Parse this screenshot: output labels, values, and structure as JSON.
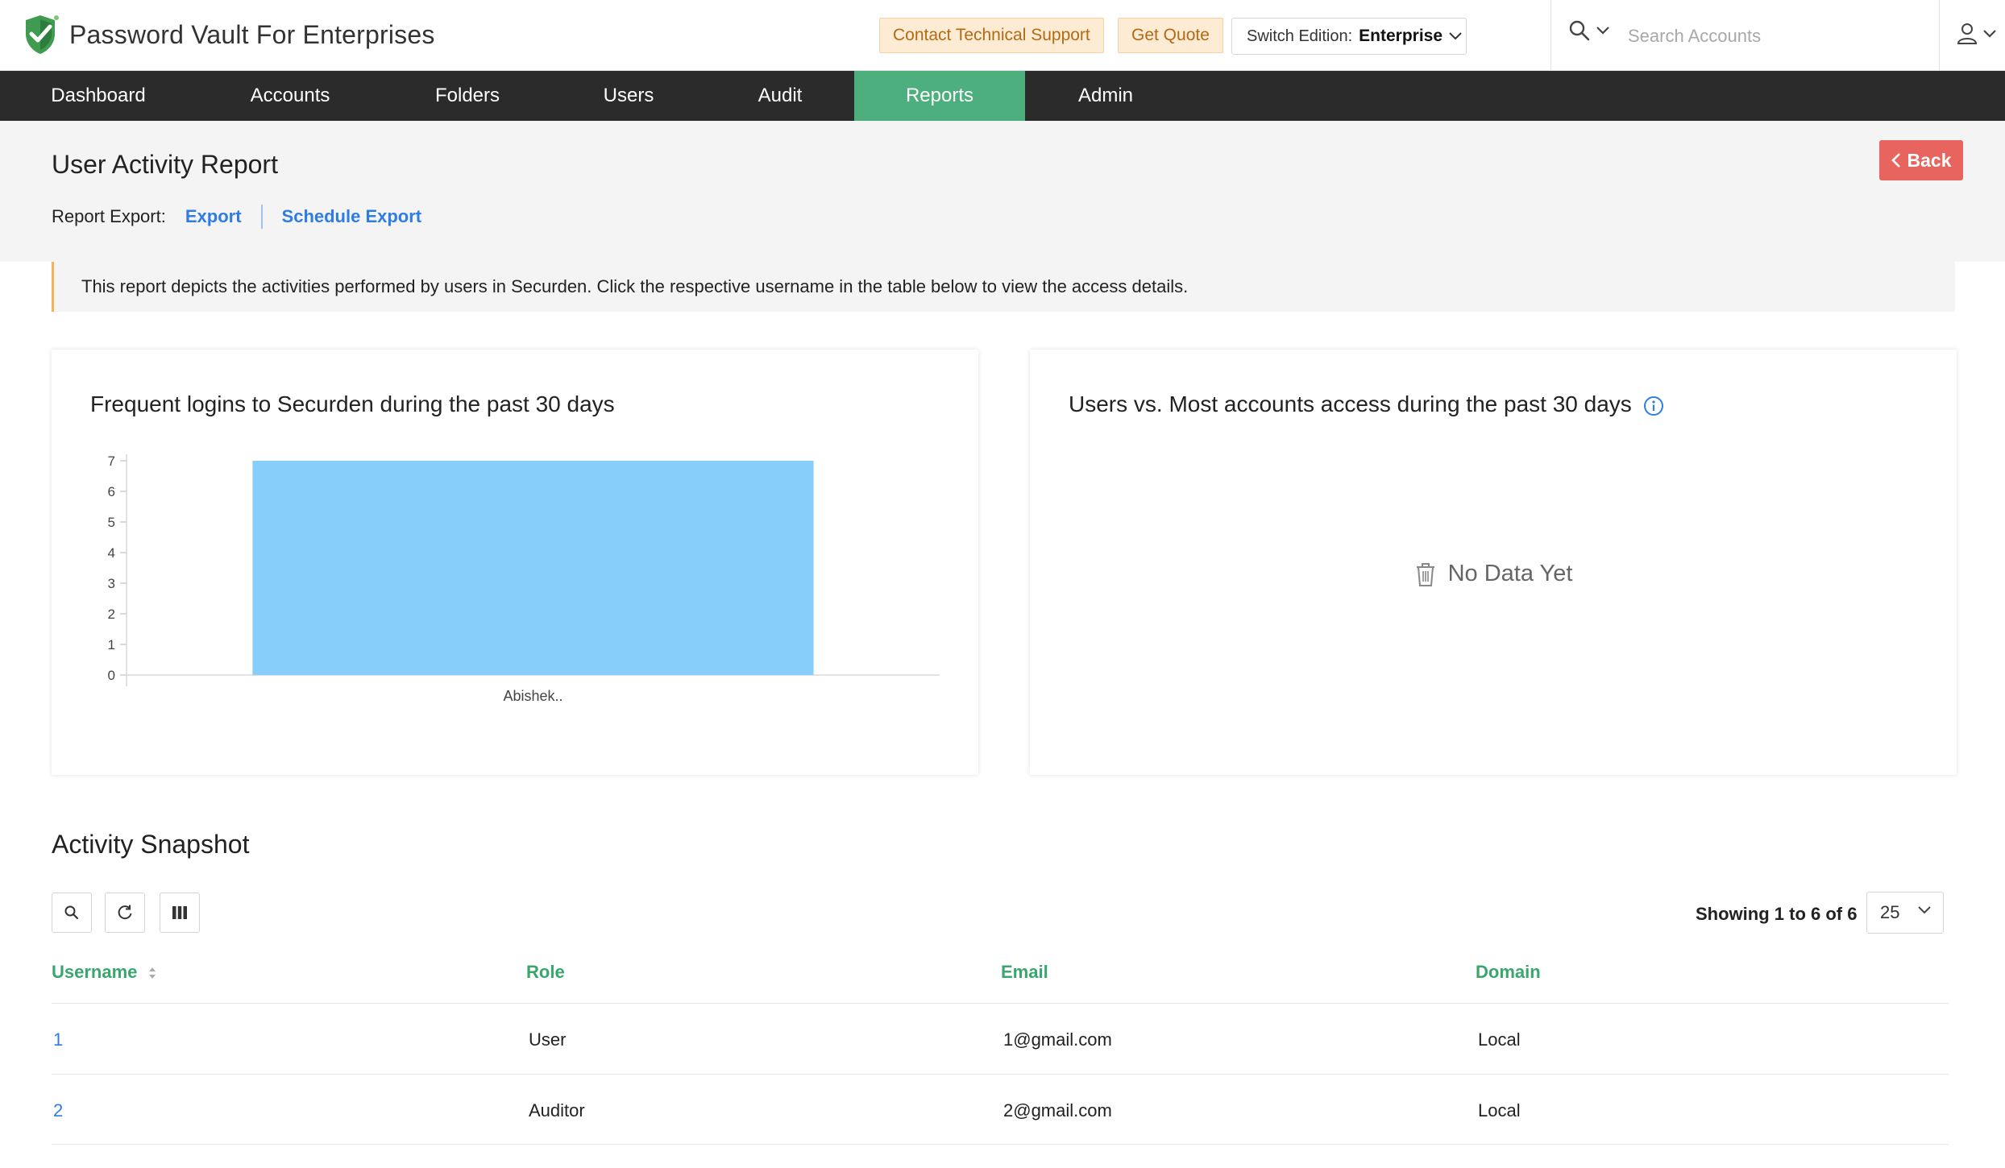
{
  "app": {
    "title": "Password Vault For Enterprises",
    "brand_color": "#3f9b4f"
  },
  "header": {
    "support_label": "Contact Technical Support",
    "quote_label": "Get Quote",
    "edition_label": "Switch Edition:",
    "edition_value": "Enterprise",
    "search_placeholder": "Search Accounts"
  },
  "nav": {
    "items": [
      {
        "label": "Dashboard"
      },
      {
        "label": "Accounts"
      },
      {
        "label": "Folders"
      },
      {
        "label": "Users"
      },
      {
        "label": "Audit"
      },
      {
        "label": "Reports",
        "active": true
      },
      {
        "label": "Admin"
      }
    ],
    "active_color": "#4caf7d"
  },
  "page": {
    "title": "User Activity Report",
    "export_label": "Report Export:",
    "export_link": "Export",
    "schedule_link": "Schedule Export",
    "back_label": "Back",
    "info_text": "This report depicts the activities performed by users in Securden. Click the respective username in the table below to view the access details."
  },
  "cards": {
    "logins_title": "Frequent logins to Securden during the past 30 days",
    "access_title": "Users vs. Most accounts access during the past 30 days",
    "no_data": "No Data Yet"
  },
  "chart_data": {
    "type": "bar",
    "title": "Frequent logins to Securden during the past 30 days",
    "categories": [
      "Abishek.."
    ],
    "values": [
      7
    ],
    "ylim": [
      0,
      7
    ],
    "yticks": [
      0,
      1,
      2,
      3,
      4,
      5,
      6,
      7
    ],
    "bar_color": "#87cefa",
    "grid": false
  },
  "snapshot": {
    "title": "Activity Snapshot",
    "showing": "Showing 1 to 6 of 6",
    "page_size": "25",
    "columns": [
      "Username",
      "Role",
      "Email",
      "Domain"
    ],
    "rows": [
      {
        "username": "1",
        "role": "User",
        "email": "1@gmail.com",
        "domain": "Local"
      },
      {
        "username": "2",
        "role": "Auditor",
        "email": "2@gmail.com",
        "domain": "Local"
      }
    ]
  }
}
